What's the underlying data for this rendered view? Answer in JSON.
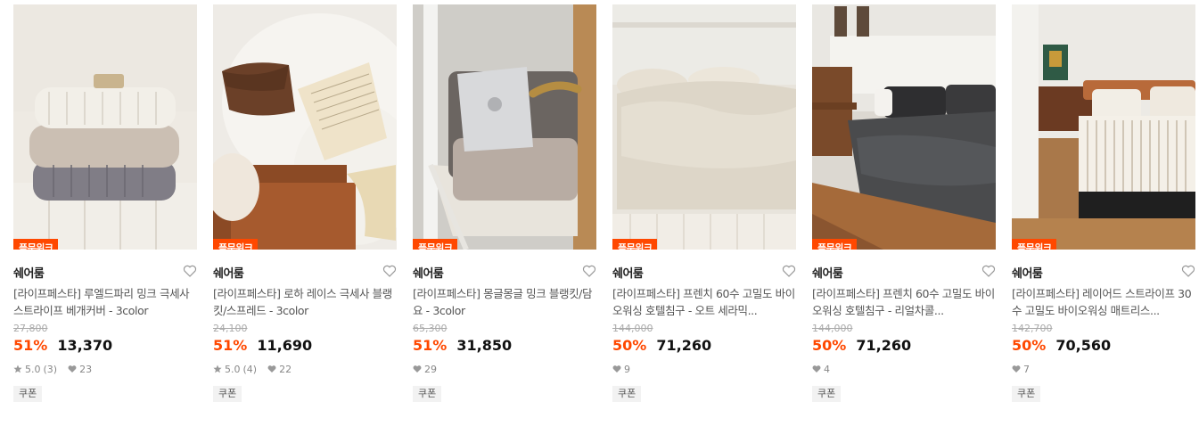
{
  "products": [
    {
      "badge": "플문위크",
      "brand": "쉐어룸",
      "title": "[라이프페스타] 루엘드파리 밍크 극세사 스트라이프 베개커버 - 3color",
      "original_price": "27,800",
      "discount": "51%",
      "price": "13,370",
      "rating": "5.0",
      "review_count": "(3)",
      "likes": "23",
      "coupon": "쿠폰",
      "image": "white-gray-pillows-on-sofa"
    },
    {
      "badge": "플문위크",
      "brand": "쉐어룸",
      "title": "[라이프페스타] 로하 레이스 극세사 블랭킷/스프레드 - 3color",
      "original_price": "24,100",
      "discount": "51%",
      "price": "11,690",
      "rating": "5.0",
      "review_count": "(4)",
      "likes": "22",
      "coupon": "쿠폰",
      "image": "lace-blanket-with-book"
    },
    {
      "badge": "플문위크",
      "brand": "쉐어룸",
      "title": "[라이프페스타] 몽글몽글 밍크 블랭킷/담요 - 3color",
      "original_price": "65,300",
      "discount": "51%",
      "price": "31,850",
      "rating": "",
      "review_count": "",
      "likes": "29",
      "coupon": "쿠폰",
      "image": "folded-blanket-with-laptop"
    },
    {
      "badge": "플문위크",
      "brand": "쉐어룸",
      "title": "[라이프페스타] 프렌치 60수 고밀도 바이오워싱 호텔침구 - 오트 세라믹...",
      "original_price": "144,000",
      "discount": "50%",
      "price": "71,260",
      "rating": "",
      "review_count": "",
      "likes": "9",
      "coupon": "쿠폰",
      "image": "oat-bedding"
    },
    {
      "badge": "플문위크",
      "brand": "쉐어룸",
      "title": "[라이프페스타] 프렌치 60수 고밀도 바이오워싱 호텔침구 - 리얼차콜...",
      "original_price": "144,000",
      "discount": "50%",
      "price": "71,260",
      "rating": "",
      "review_count": "",
      "likes": "4",
      "coupon": "쿠폰",
      "image": "charcoal-bedding"
    },
    {
      "badge": "플문위크",
      "brand": "쉐어룸",
      "title": "[라이프페스타] 레이어드 스트라이프 30수 고밀도 바이오워싱 매트리스...",
      "original_price": "142,700",
      "discount": "50%",
      "price": "70,560",
      "rating": "",
      "review_count": "",
      "likes": "7",
      "coupon": "쿠폰",
      "image": "striped-mattress-cover"
    }
  ],
  "colors": {
    "accent": "#ff4800",
    "badge_text": "#ffffff",
    "strike": "#aaaaaa",
    "coupon_bg": "#f2f2f2"
  }
}
